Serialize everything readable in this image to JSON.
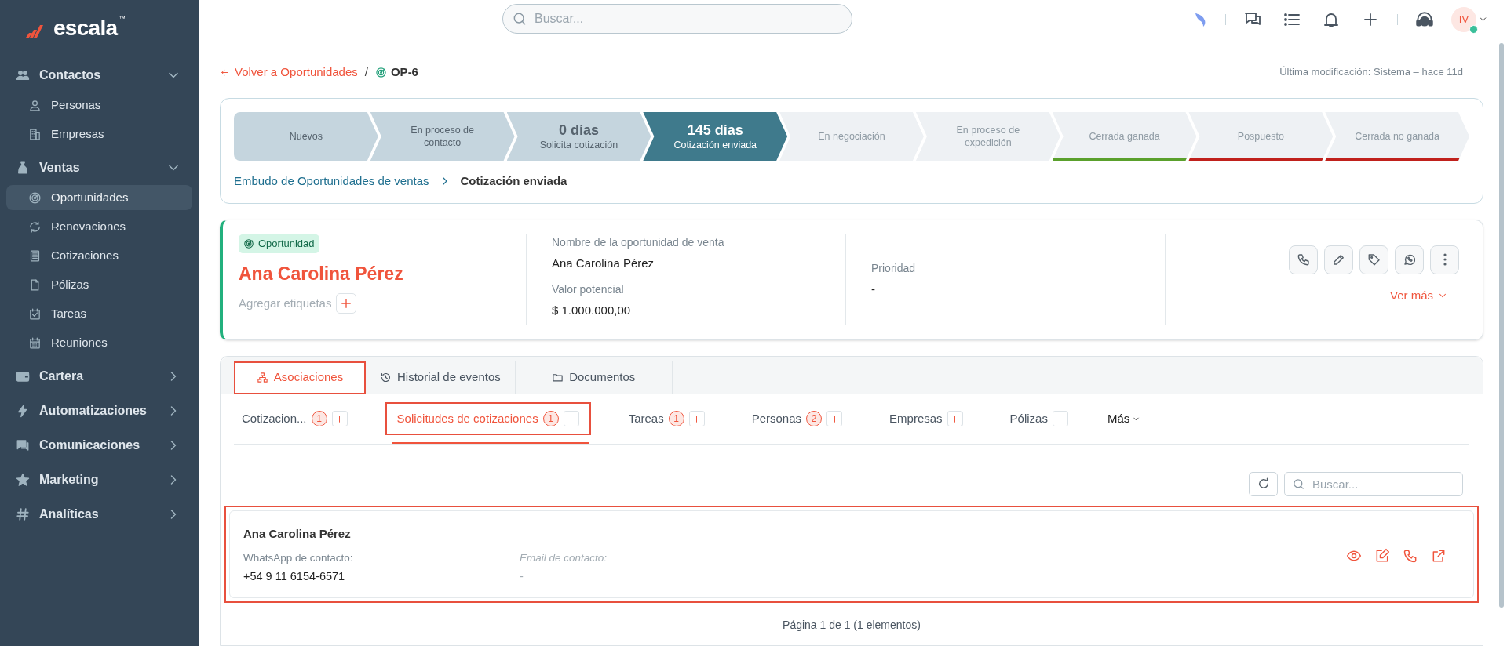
{
  "app": {
    "logo": "escala",
    "logo_tm": "™"
  },
  "search": {
    "placeholder": "Buscar..."
  },
  "user": {
    "initials": "IV",
    "online": true
  },
  "sidebar": {
    "sections": [
      {
        "label": "Contactos",
        "expanded": true,
        "children": [
          {
            "label": "Personas",
            "selected": false
          },
          {
            "label": "Empresas",
            "selected": false
          }
        ]
      },
      {
        "label": "Ventas",
        "expanded": true,
        "children": [
          {
            "label": "Oportunidades",
            "selected": true
          },
          {
            "label": "Renovaciones",
            "selected": false
          },
          {
            "label": "Cotizaciones",
            "selected": false
          },
          {
            "label": "Pólizas",
            "selected": false
          },
          {
            "label": "Tareas",
            "selected": false
          },
          {
            "label": "Reuniones",
            "selected": false
          }
        ]
      },
      {
        "label": "Cartera",
        "expanded": false
      },
      {
        "label": "Automatizaciones",
        "expanded": false
      },
      {
        "label": "Comunicaciones",
        "expanded": false
      },
      {
        "label": "Marketing",
        "expanded": false
      },
      {
        "label": "Analíticas",
        "expanded": false
      }
    ]
  },
  "breadcrumb": {
    "back": "Volver a Oportunidades",
    "separator": "/",
    "current": "OP-6"
  },
  "last_modified": "Última modificación: Sistema – hace 11d",
  "pipeline": {
    "stages": [
      {
        "label": "Nuevos",
        "completed": true,
        "selected": false
      },
      {
        "label": "En proceso de contacto",
        "completed": true,
        "selected": false
      },
      {
        "label": "Solicita cotización",
        "days": "0 días",
        "completed": true,
        "selected": false
      },
      {
        "label": "Cotización enviada",
        "days": "145 días",
        "completed": false,
        "selected": true
      },
      {
        "label": "En negociación",
        "completed": false,
        "selected": false
      },
      {
        "label": "En proceso de expedición",
        "completed": false,
        "selected": false
      },
      {
        "label": "Cerrada ganada",
        "completed": false,
        "selected": false,
        "color": "#5aa02c"
      },
      {
        "label": "Pospuesto",
        "completed": false,
        "selected": false,
        "color": "#c0211c"
      },
      {
        "label": "Cerrada no ganada",
        "completed": false,
        "selected": false,
        "color": "#c0211c"
      }
    ],
    "funnel": "Embudo de Oportunidades de ventas",
    "current_stage": "Cotización enviada"
  },
  "opportunity": {
    "badge": "Oportunidad",
    "name": "Ana Carolina Pérez",
    "add_tags": "Agregar etiquetas",
    "columns": [
      [
        {
          "label": "Nombre de la oportunidad de venta",
          "value": "Ana Carolina Pérez"
        },
        {
          "label": "Valor potencial",
          "value": "$ 1.000.000,00"
        }
      ],
      [
        {
          "label": "Prioridad",
          "value": "-"
        }
      ]
    ],
    "see_more": "Ver más"
  },
  "tabs": [
    {
      "label": "Asociaciones",
      "selected": true,
      "highlighted": true
    },
    {
      "label": "Historial de eventos",
      "selected": false,
      "highlighted": false
    },
    {
      "label": "Documentos",
      "selected": false,
      "highlighted": false
    }
  ],
  "subtabs": [
    {
      "label": "Cotizacion...",
      "count": "1",
      "selected": false,
      "highlighted": false
    },
    {
      "label": "Solicitudes de cotizaciones",
      "count": "1",
      "selected": true,
      "highlighted": true
    },
    {
      "label": "Tareas",
      "count": "1",
      "selected": false,
      "highlighted": false
    },
    {
      "label": "Personas",
      "count": "2",
      "selected": false,
      "highlighted": false
    },
    {
      "label": "Empresas",
      "selected": false,
      "highlighted": false
    },
    {
      "label": "Pólizas",
      "selected": false,
      "highlighted": false
    }
  ],
  "more": "Más",
  "list": {
    "search_placeholder": "Buscar...",
    "records": [
      {
        "title": "Ana Carolina Pérez",
        "highlighted": true,
        "fields": [
          {
            "label": "WhatsApp de contacto:",
            "value": "+54 9 11 6154-6571",
            "empty": false
          },
          {
            "label": "Email de contacto:",
            "value": "-",
            "empty": true
          }
        ]
      }
    ],
    "pagination": "Página 1 de 1 (1 elementos)"
  }
}
